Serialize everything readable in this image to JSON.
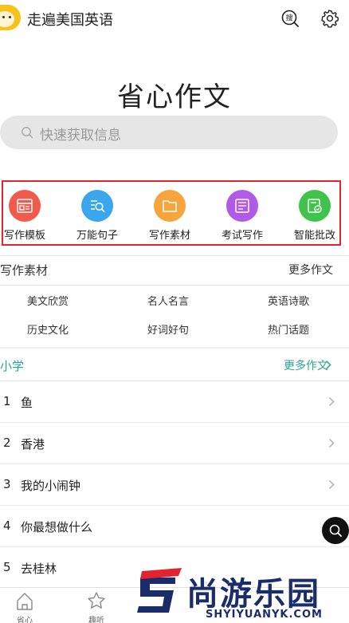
{
  "header": {
    "app_title": "走遍美国英语",
    "search_icon": "search-icon",
    "settings_icon": "gear-icon"
  },
  "page_title": "省心作文",
  "search": {
    "placeholder": "快速获取信息"
  },
  "categories": [
    {
      "label": "写作模板",
      "color": "#f25a4c",
      "icon": "template-icon"
    },
    {
      "label": "万能句子",
      "color": "#3aa6ee",
      "icon": "sentence-search-icon"
    },
    {
      "label": "写作素材",
      "color": "#f6a53c",
      "icon": "folder-icon"
    },
    {
      "label": "考试写作",
      "color": "#b05ae8",
      "icon": "exam-sheet-icon"
    },
    {
      "label": "智能批改",
      "color": "#40c34c",
      "icon": "smart-correct-icon"
    }
  ],
  "materials_section": {
    "title": "写作素材",
    "more": "更多作文",
    "items": [
      "美文欣赏",
      "名人名言",
      "英语诗歌",
      "历史文化",
      "好词好句",
      "热门话题"
    ]
  },
  "primary_section": {
    "title": "小学",
    "more": "更多作文",
    "accent": "#2aa58a",
    "items": [
      {
        "num": "1",
        "title": "鱼"
      },
      {
        "num": "2",
        "title": "香港"
      },
      {
        "num": "3",
        "title": "我的小闹钟"
      },
      {
        "num": "4",
        "title": "你最想做什么"
      },
      {
        "num": "5",
        "title": "去桂林"
      }
    ]
  },
  "tabbar": {
    "tabs": [
      {
        "label": "省心",
        "icon": "home-icon"
      },
      {
        "label": "趣听",
        "icon": "star-icon"
      }
    ]
  },
  "watermark": {
    "main": "尚游乐园",
    "url": "SHYIYUANYK.COM"
  },
  "colors": {
    "highlight_border": "#e5252e",
    "accent": "#2aa58a"
  }
}
